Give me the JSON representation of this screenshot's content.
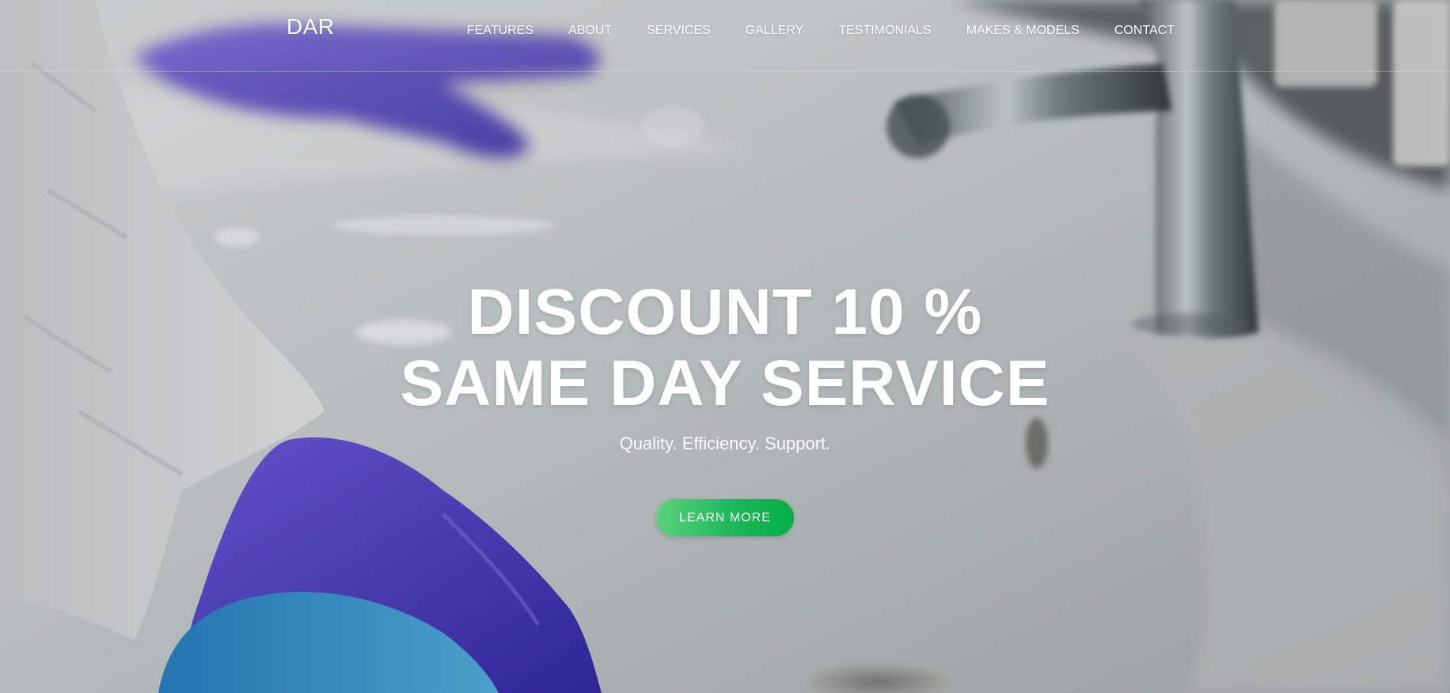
{
  "brand": "DAR",
  "nav": {
    "items": [
      {
        "label": "FEATURES"
      },
      {
        "label": "ABOUT"
      },
      {
        "label": "SERVICES"
      },
      {
        "label": "GALLERY"
      },
      {
        "label": "TESTIMONIALS"
      },
      {
        "label": "MAKES & MODELS"
      },
      {
        "label": "CONTACT"
      }
    ]
  },
  "hero": {
    "headline_line1": "DISCOUNT 10 %",
    "headline_line2": "SAME DAY SERVICE",
    "subheadline": "Quality. Efficiency. Support.",
    "cta_label": "LEARN MORE",
    "background_image": "sink-cleaning-gloved-hands-photo"
  },
  "colors": {
    "text": "#ffffff",
    "button_gradient_start": "#5bd27c",
    "button_gradient_end": "#05ae45",
    "glove": "#4a34c9"
  }
}
